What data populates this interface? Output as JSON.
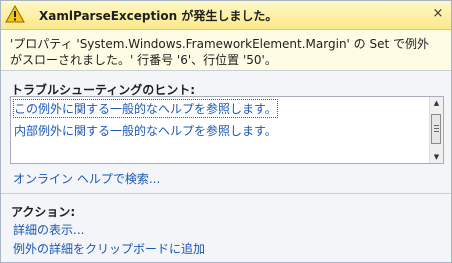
{
  "title_bar": {
    "title": "XamlParseException が発生しました。",
    "close_glyph": "×"
  },
  "message": {
    "line1": "'プロパティ 'System.Windows.FrameworkElement.Margin' の Set で例外",
    "line2": "がスローされました。' 行番号 '6'、行位置 '50'。"
  },
  "troubleshooting": {
    "header": "トラブルシューティングのヒント:",
    "items": [
      "この例外に関する一般的なヘルプを参照します。",
      "内部例外に関する一般的なヘルプを参照します。"
    ]
  },
  "online_help_link": "オンライン ヘルプで検索...",
  "actions": {
    "header": "アクション:",
    "items": [
      "詳細の表示...",
      "例外の詳細をクリップボードに追加"
    ]
  },
  "icons": {
    "warning": "warning-icon",
    "close": "close-icon"
  },
  "colors": {
    "title_bar": "#fbe98a",
    "message_background": "#fffce6",
    "link": "#1a58b8"
  }
}
